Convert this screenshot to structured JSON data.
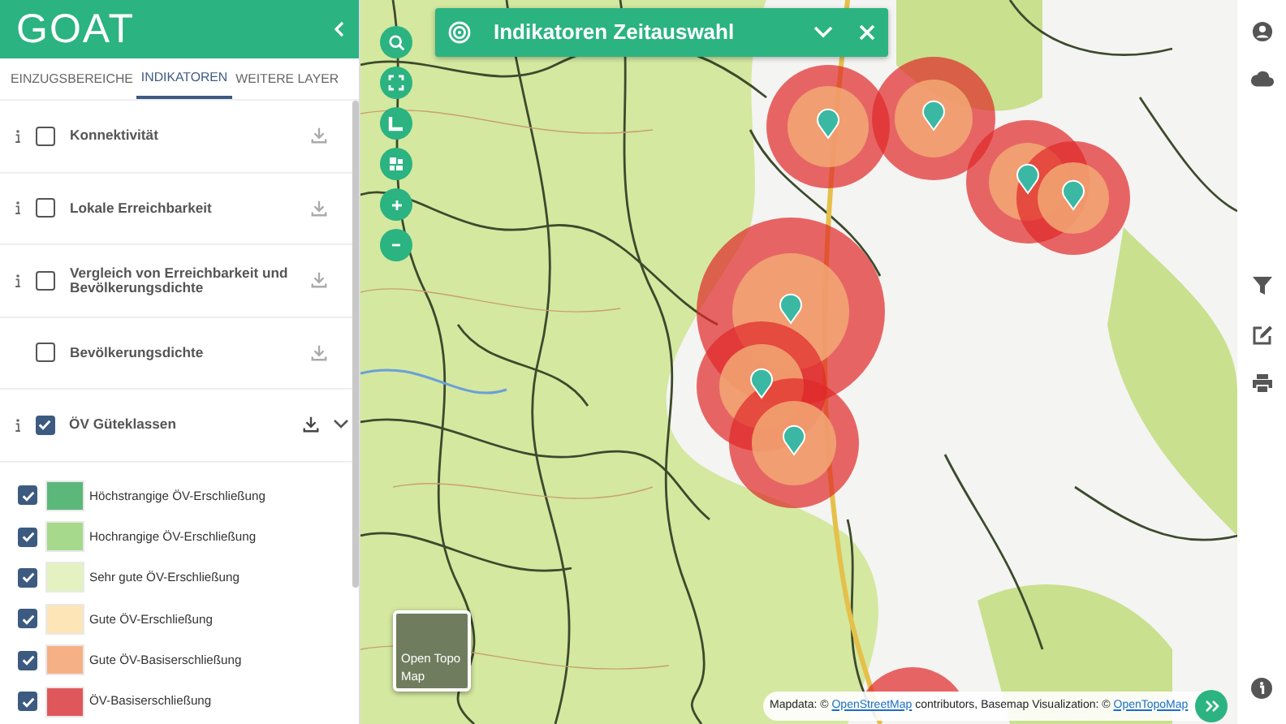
{
  "header": {
    "logo": "GOAT"
  },
  "tabs": [
    {
      "label": "EINZUGSBEREICHE",
      "selected": false
    },
    {
      "label": "INDIKATOREN",
      "selected": true
    },
    {
      "label": "WEITERE LAYER",
      "selected": false
    }
  ],
  "layers": [
    {
      "label": "Konnektivität",
      "info": true,
      "checked": false,
      "expanded": false
    },
    {
      "label": "Lokale Erreichbarkeit",
      "info": true,
      "checked": false,
      "expanded": false
    },
    {
      "label": "Vergleich von Erreichbarkeit und Bevölkerungsdichte",
      "info": true,
      "checked": false,
      "expanded": false
    },
    {
      "label": "Bevölkerungsdichte",
      "info": false,
      "checked": false,
      "expanded": false
    },
    {
      "label": "ÖV Güteklassen",
      "info": true,
      "checked": true,
      "expanded": true
    }
  ],
  "legend": [
    {
      "label": "Höchstrangige ÖV-Erschließung",
      "color": "#5bb87a",
      "checked": true
    },
    {
      "label": "Hochrangige ÖV-Erschließung",
      "color": "#a6d98c",
      "checked": true
    },
    {
      "label": "Sehr gute ÖV-Erschließung",
      "color": "#e3f2c0",
      "checked": true
    },
    {
      "label": "Gute ÖV-Erschließung",
      "color": "#fde5b8",
      "checked": true
    },
    {
      "label": "Gute ÖV-Basiserschließung",
      "color": "#f6b085",
      "checked": true
    },
    {
      "label": "ÖV-Basiserschließung",
      "color": "#e0575b",
      "checked": true
    }
  ],
  "panel": {
    "title": "Indikatoren Zeitauswahl"
  },
  "basemap": {
    "label": "Open Topo Map"
  },
  "attribution": {
    "parts": [
      {
        "kind": "text",
        "text": "Mapdata: © "
      },
      {
        "kind": "link",
        "text": "OpenStreetMap"
      },
      {
        "kind": "text",
        "text": " contributors, Basemap Visualization: © "
      },
      {
        "kind": "link",
        "text": "OpenTopoMap"
      }
    ]
  }
}
